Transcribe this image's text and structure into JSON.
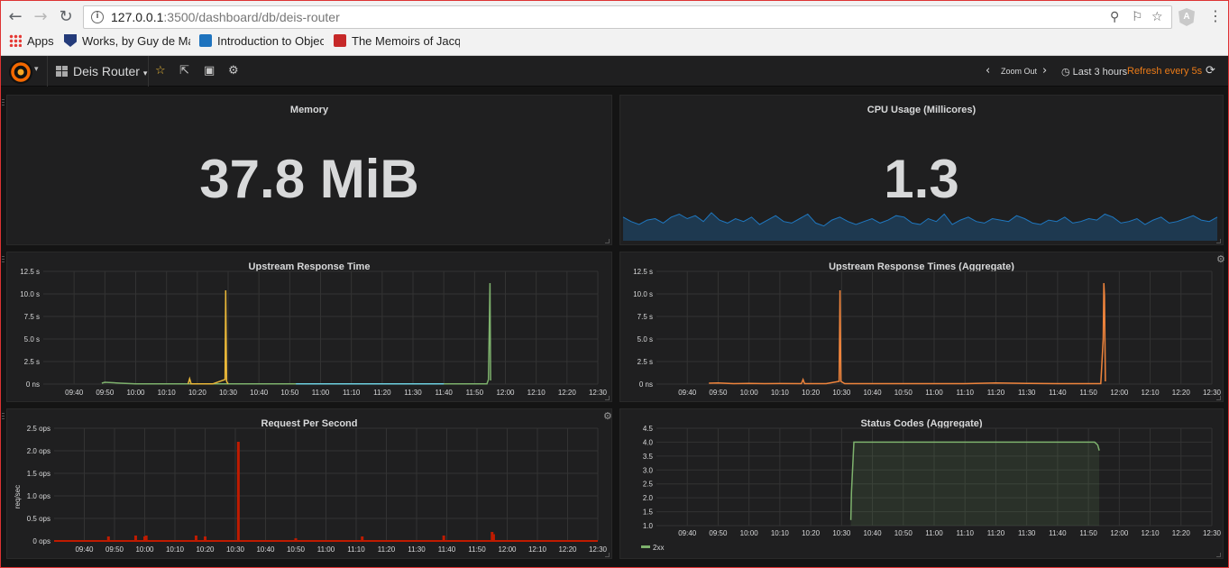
{
  "browser": {
    "url_host": "127.0.0.1",
    "url_rest": ":3500/dashboard/db/deis-router",
    "bookmarks": [
      {
        "label": "Apps",
        "icon": "apps-grid-icon"
      },
      {
        "label": "Works, by Guy de Ma",
        "icon": "shield-icon"
      },
      {
        "label": "Introduction to Objec",
        "icon": "book-icon"
      },
      {
        "label": "The Memoirs of Jacqu",
        "icon": "gutenberg-icon"
      }
    ]
  },
  "navbar": {
    "dashboard_title": "Deis Router",
    "zoom_out": "Zoom Out",
    "time_range": "Last 3 hours",
    "refresh": "Refresh every 5s"
  },
  "colors": {
    "background": "#141414",
    "panel": "#1f1f20",
    "text": "#d8d9da",
    "refresh_accent": "#eb7b18",
    "sparkline": "#1f78c1"
  },
  "panels": {
    "memory": {
      "title": "Memory",
      "value": "37.8 MiB"
    },
    "cpu": {
      "title": "CPU Usage (Millicores)",
      "value": "1.3"
    },
    "upstream": {
      "title": "Upstream Response Time"
    },
    "upstream_agg": {
      "title": "Upstream Response Times (Aggregate)"
    },
    "rps": {
      "title": "Request Per Second",
      "ylabel": "req/sec"
    },
    "status": {
      "title": "Status Codes (Aggregate)",
      "legend": "2xx"
    }
  },
  "chart_data": [
    {
      "id": "upstream",
      "type": "line",
      "title": "Upstream Response Time",
      "x_ticks": [
        "09:40",
        "09:50",
        "10:00",
        "10:10",
        "10:20",
        "10:30",
        "10:40",
        "10:50",
        "11:00",
        "11:10",
        "11:20",
        "11:30",
        "11:40",
        "11:50",
        "12:00",
        "12:10",
        "12:20",
        "12:30"
      ],
      "y_ticks": [
        "0 ns",
        "2.5 s",
        "5.0 s",
        "7.5 s",
        "10.0 s",
        "12.5 s"
      ],
      "xlim": [
        0,
        18
      ],
      "ylim": [
        0,
        12.5
      ],
      "grid": true,
      "series": [
        {
          "color": "#7eb26d",
          "points": [
            [
              1.9,
              0.1
            ],
            [
              2.0,
              0.2
            ],
            [
              2.5,
              0.1
            ],
            [
              3.0,
              0.02
            ],
            [
              4.0,
              0.02
            ],
            [
              5.0,
              0.02
            ],
            [
              5.6,
              0.02
            ],
            [
              6.0,
              0.02
            ],
            [
              8.0,
              0.02
            ],
            [
              11.0,
              0.02
            ],
            [
              13.0,
              0.02
            ],
            [
              14.0,
              0.02
            ],
            [
              14.4,
              0.02
            ],
            [
              14.45,
              0.5
            ],
            [
              14.5,
              11.2
            ],
            [
              14.52,
              0.4
            ]
          ]
        },
        {
          "color": "#eab839",
          "points": [
            [
              4.7,
              0.02
            ],
            [
              4.75,
              0.6
            ],
            [
              4.8,
              0.02
            ],
            [
              5.5,
              0.02
            ],
            [
              5.9,
              0.5
            ],
            [
              5.92,
              10.4
            ],
            [
              5.95,
              0.3
            ],
            [
              6.0,
              0.02
            ]
          ]
        },
        {
          "color": "#6ed0e0",
          "points": [
            [
              8.2,
              0.02
            ],
            [
              10.0,
              0.02
            ],
            [
              12.0,
              0.02
            ],
            [
              13.0,
              0.02
            ]
          ]
        }
      ]
    },
    {
      "id": "upstream_agg",
      "type": "line",
      "title": "Upstream Response Times (Aggregate)",
      "x_ticks": [
        "09:40",
        "09:50",
        "10:00",
        "10:10",
        "10:20",
        "10:30",
        "10:40",
        "10:50",
        "11:00",
        "11:10",
        "11:20",
        "11:30",
        "11:40",
        "11:50",
        "12:00",
        "12:10",
        "12:20",
        "12:30"
      ],
      "y_ticks": [
        "0 ns",
        "2.5 s",
        "5.0 s",
        "7.5 s",
        "10.0 s",
        "12.5 s"
      ],
      "xlim": [
        0,
        18
      ],
      "ylim": [
        0,
        12.5
      ],
      "grid": true,
      "series": [
        {
          "color": "#ef843c",
          "points": [
            [
              1.7,
              0.1
            ],
            [
              2.0,
              0.12
            ],
            [
              2.5,
              0.05
            ],
            [
              3.0,
              0.08
            ],
            [
              3.5,
              0.05
            ],
            [
              4.0,
              0.06
            ],
            [
              4.7,
              0.05
            ],
            [
              4.75,
              0.5
            ],
            [
              4.8,
              0.05
            ],
            [
              5.5,
              0.05
            ],
            [
              5.92,
              0.3
            ],
            [
              5.95,
              10.4
            ],
            [
              5.98,
              0.3
            ],
            [
              6.1,
              0.05
            ],
            [
              8.0,
              0.05
            ],
            [
              10.0,
              0.05
            ],
            [
              11.0,
              0.12
            ],
            [
              12.0,
              0.08
            ],
            [
              13.0,
              0.05
            ],
            [
              14.4,
              0.05
            ],
            [
              14.48,
              5.0
            ],
            [
              14.5,
              11.2
            ],
            [
              14.52,
              9.8
            ],
            [
              14.55,
              0.3
            ]
          ]
        }
      ]
    },
    {
      "id": "rps",
      "type": "bar",
      "title": "Request Per Second",
      "ylabel": "req/sec",
      "x_ticks": [
        "09:40",
        "09:50",
        "10:00",
        "10:10",
        "10:20",
        "10:30",
        "10:40",
        "10:50",
        "11:00",
        "11:10",
        "11:20",
        "11:30",
        "11:40",
        "11:50",
        "12:00",
        "12:10",
        "12:20",
        "12:30"
      ],
      "y_ticks": [
        "0 ops",
        "0.5 ops",
        "1.0 ops",
        "1.5 ops",
        "2.0 ops",
        "2.5 ops"
      ],
      "xlim": [
        0,
        18
      ],
      "ylim": [
        0,
        2.5
      ],
      "grid": true,
      "color": "#bf1b00",
      "bars": [
        [
          1.8,
          0.1
        ],
        [
          2.7,
          0.12
        ],
        [
          3.0,
          0.1
        ],
        [
          3.05,
          0.12
        ],
        [
          4.7,
          0.12
        ],
        [
          5.0,
          0.1
        ],
        [
          6.1,
          2.2
        ],
        [
          8.0,
          0.06
        ],
        [
          10.2,
          0.1
        ],
        [
          12.9,
          0.12
        ],
        [
          14.5,
          0.2
        ],
        [
          14.55,
          0.15
        ]
      ]
    },
    {
      "id": "status",
      "type": "area",
      "title": "Status Codes (Aggregate)",
      "x_ticks": [
        "09:40",
        "09:50",
        "10:00",
        "10:10",
        "10:20",
        "10:30",
        "10:40",
        "10:50",
        "11:00",
        "11:10",
        "11:20",
        "11:30",
        "11:40",
        "11:50",
        "12:00",
        "12:10",
        "12:20",
        "12:30"
      ],
      "y_ticks": [
        "1.0",
        "1.5",
        "2.0",
        "2.5",
        "3.0",
        "3.5",
        "4.0",
        "4.5"
      ],
      "xlim": [
        0,
        18
      ],
      "ylim": [
        1.0,
        4.5
      ],
      "grid": true,
      "legend": "bottom-left",
      "series": [
        {
          "name": "2xx",
          "color": "#7eb26d",
          "points": [
            [
              6.3,
              1.2
            ],
            [
              6.32,
              2.2
            ],
            [
              6.4,
              4.0
            ],
            [
              8.0,
              4.0
            ],
            [
              10.0,
              4.0
            ],
            [
              12.0,
              4.0
            ],
            [
              14.2,
              4.0
            ],
            [
              14.3,
              3.9
            ],
            [
              14.35,
              3.7
            ]
          ]
        }
      ]
    },
    {
      "id": "cpu_spark",
      "type": "area",
      "title": "",
      "color": "#1f78c1",
      "values": [
        1.6,
        1.3,
        1.1,
        1.4,
        1.5,
        1.2,
        1.6,
        1.8,
        1.5,
        1.7,
        1.3,
        1.9,
        1.4,
        1.2,
        1.5,
        1.3,
        1.6,
        1.1,
        1.4,
        1.7,
        1.3,
        1.2,
        1.5,
        1.8,
        1.2,
        1.0,
        1.4,
        1.6,
        1.3,
        1.1,
        1.3,
        1.5,
        1.2,
        1.4,
        1.7,
        1.6,
        1.2,
        1.1,
        1.5,
        1.3,
        1.8,
        1.1,
        1.4,
        1.6,
        1.3,
        1.2,
        1.5,
        1.4,
        1.3,
        1.7,
        1.5,
        1.2,
        1.1,
        1.4,
        1.3,
        1.6,
        1.2,
        1.3,
        1.5,
        1.4,
        1.8,
        1.6,
        1.2,
        1.3,
        1.5,
        1.1,
        1.4,
        1.6,
        1.2,
        1.3,
        1.5,
        1.7,
        1.4,
        1.3,
        1.6
      ]
    }
  ]
}
